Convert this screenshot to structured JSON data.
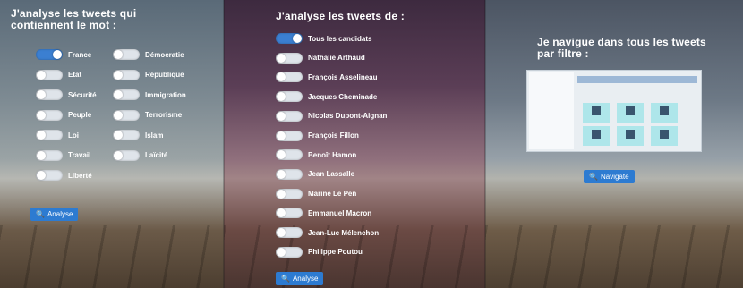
{
  "panel1": {
    "title_line1": "J'analyse les tweets qui",
    "title_line2": "contiennent le mot :",
    "toggles_left": [
      {
        "label": "France",
        "on": true
      },
      {
        "label": "Etat",
        "on": false
      },
      {
        "label": "Sécurité",
        "on": false
      },
      {
        "label": "Peuple",
        "on": false
      },
      {
        "label": "Loi",
        "on": false
      },
      {
        "label": "Travail",
        "on": false
      },
      {
        "label": "Liberté",
        "on": false
      }
    ],
    "toggles_right": [
      {
        "label": "Démocratie",
        "on": false
      },
      {
        "label": "République",
        "on": false
      },
      {
        "label": "Immigration",
        "on": false
      },
      {
        "label": "Terrorisme",
        "on": false
      },
      {
        "label": "Islam",
        "on": false
      },
      {
        "label": "Laïcité",
        "on": false
      }
    ],
    "button": "Analyse"
  },
  "panel2": {
    "title": "J'analyse les tweets de :",
    "toggles": [
      {
        "label": "Tous les candidats",
        "on": true
      },
      {
        "label": "Nathalie Arthaud",
        "on": false
      },
      {
        "label": "François Asselineau",
        "on": false
      },
      {
        "label": "Jacques Cheminade",
        "on": false
      },
      {
        "label": "Nicolas Dupont-Aignan",
        "on": false
      },
      {
        "label": "François Fillon",
        "on": false
      },
      {
        "label": "Benoît Hamon",
        "on": false
      },
      {
        "label": "Jean Lassalle",
        "on": false
      },
      {
        "label": "Marine Le Pen",
        "on": false
      },
      {
        "label": "Emmanuel Macron",
        "on": false
      },
      {
        "label": "Jean-Luc Mélenchon",
        "on": false
      },
      {
        "label": "Philippe Poutou",
        "on": false
      }
    ],
    "button": "Analyse"
  },
  "panel3": {
    "title_line1": "Je navigue dans tous les tweets",
    "title_line2": "par filtre :",
    "button": "Navigate"
  },
  "colors": {
    "accent": "#2d7bd1",
    "toggle_on": "#3b7fd1",
    "toggle_off": "#dfe4ea"
  }
}
